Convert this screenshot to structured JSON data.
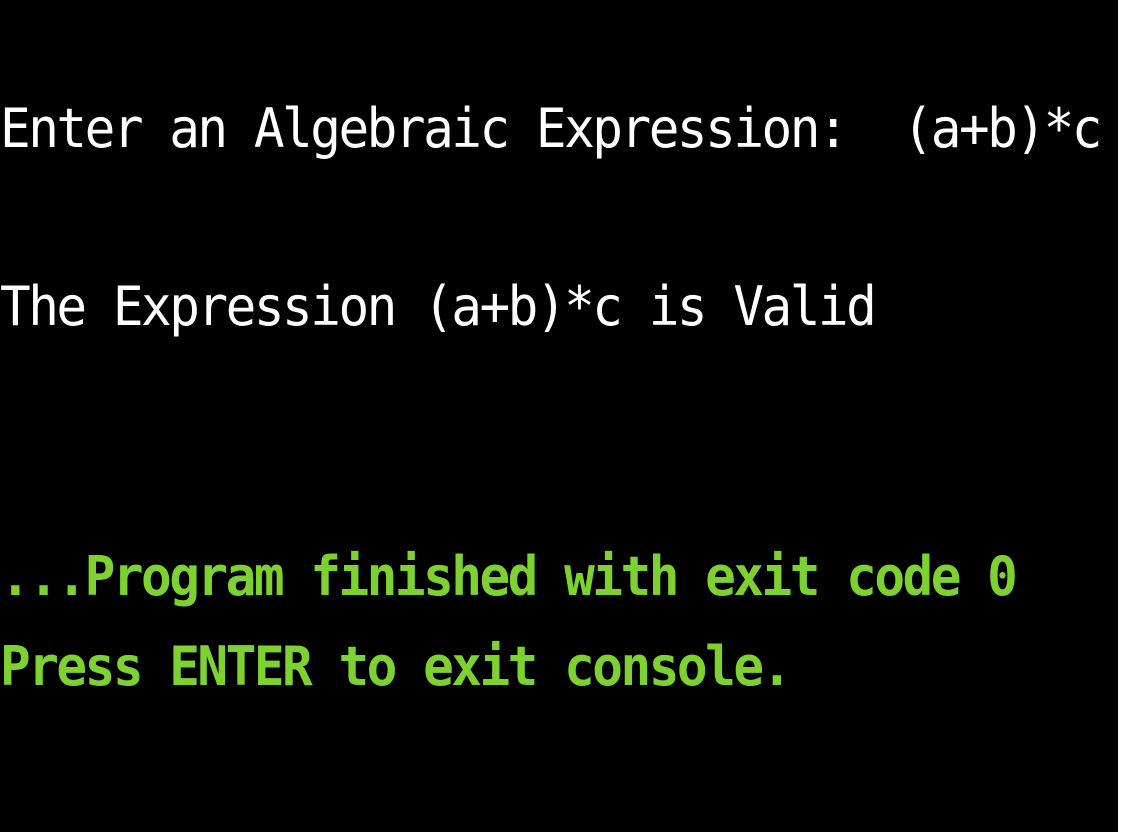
{
  "console": {
    "prompt_label": "Enter an Algebraic Expression:  ",
    "input_value": "(a+b)*c",
    "result_text": "The Expression (a+b)*c is Valid",
    "exit_message": "...Program finished with exit code 0",
    "press_enter_message": "Press ENTER to exit console."
  },
  "colors": {
    "background": "#000000",
    "output_text": "#ffffff",
    "status_text": "#7ed22f"
  }
}
